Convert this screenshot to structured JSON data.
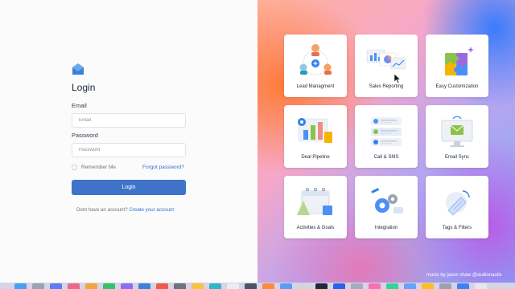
{
  "window": {
    "traffic_colors": [
      "#ff5f57",
      "#febc2e",
      "#28c840"
    ]
  },
  "login": {
    "title": "Login",
    "email_label": "Email",
    "email_placeholder": "Email",
    "password_label": "Password",
    "password_placeholder": "Password",
    "remember_label": "Remember Me",
    "forgot_label": "Forgot password?",
    "submit_label": "Login",
    "signup_prompt": "Dont have an account?",
    "signup_link": "Create your account"
  },
  "features": {
    "items": [
      {
        "label": "Lead Managment",
        "icon": "people-network-icon"
      },
      {
        "label": "Sales Reporting",
        "icon": "report-charts-icon"
      },
      {
        "label": "Easy Customization",
        "icon": "puzzle-icon"
      },
      {
        "label": "Deal Pipeline",
        "icon": "bar-chart-board-icon"
      },
      {
        "label": "Call & SMS",
        "icon": "message-list-icon"
      },
      {
        "label": "Email Sync",
        "icon": "monitor-sync-icon"
      },
      {
        "label": "Activities & Goals",
        "icon": "calendar-icon"
      },
      {
        "label": "Integration",
        "icon": "gears-icon"
      },
      {
        "label": "Tags & Filters",
        "icon": "tag-icon"
      }
    ]
  },
  "credit": "music by jason shaw @audionautix",
  "colors": {
    "accent": "#3e73c9",
    "link": "#2f6fd1"
  }
}
